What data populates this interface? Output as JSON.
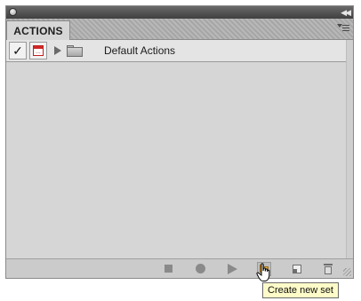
{
  "panel": {
    "tab_label": "ACTIONS",
    "menu_icon": "panel-menu-icon"
  },
  "actions": [
    {
      "label": "Default Actions",
      "checked": true,
      "check_mark": "✓",
      "dialog_icon_dots": "...",
      "expanded": false
    }
  ],
  "bottombar": {
    "buttons": [
      "stop-icon",
      "record-icon",
      "play-icon",
      "new-set-icon",
      "new-action-icon",
      "trash-icon"
    ]
  },
  "tooltip": {
    "text": "Create new set"
  },
  "colors": {
    "panel_bg": "#d6d6d6",
    "dialog_red": "#d02828",
    "tooltip_bg": "#fdfbc8"
  }
}
